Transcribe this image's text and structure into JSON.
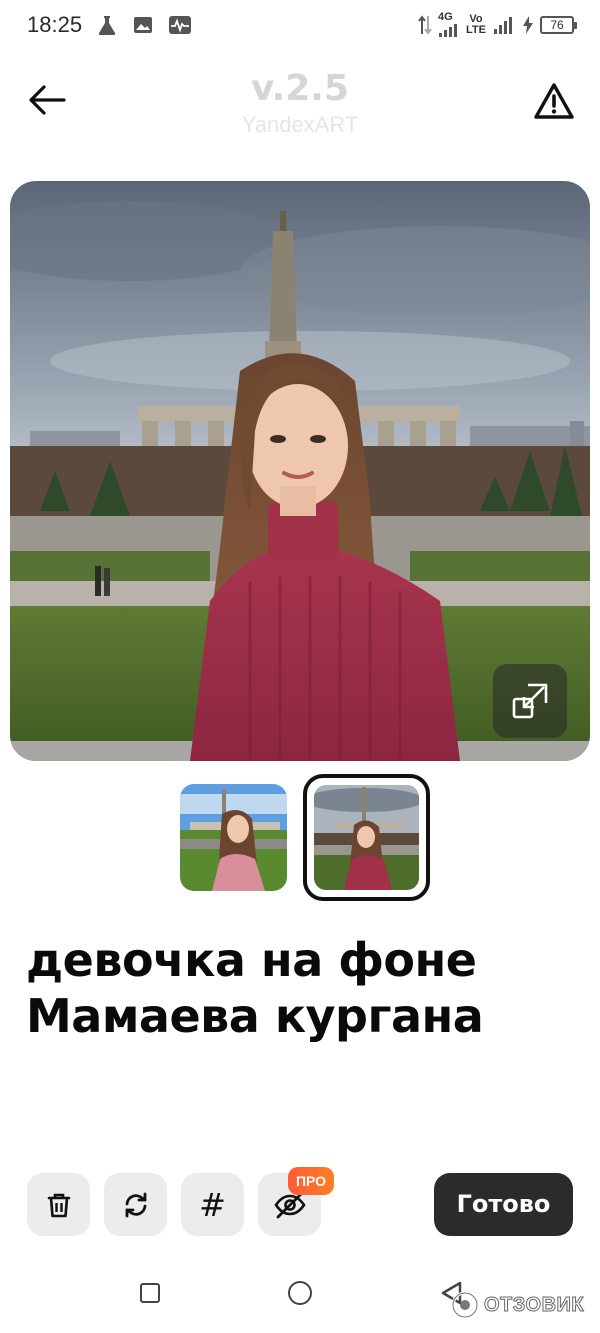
{
  "status_bar": {
    "time": "18:25",
    "network_type": "4G",
    "volte_top": "Vo",
    "volte_bottom": "LTE",
    "battery_level": "76",
    "icons": [
      "flask-icon",
      "image-icon",
      "activity-monitor-icon",
      "data-arrows-icon",
      "signal-icon",
      "charging-icon",
      "battery-icon"
    ]
  },
  "header": {
    "version": "v.2.5",
    "brand": "YandexART",
    "back_icon": "arrow-left-icon",
    "warning_icon": "warning-triangle-icon"
  },
  "main_image": {
    "description_icon": "photo",
    "expand_icon": "expand-icon"
  },
  "thumbnails": {
    "count": 2,
    "selected_index": 1
  },
  "prompt": {
    "text": "девочка на фоне Мамаева кургана"
  },
  "toolbar": {
    "delete_icon": "trash-icon",
    "regenerate_icon": "refresh-icon",
    "hashtag_glyph": "#",
    "hide_icon": "eye-off-icon",
    "pro_badge": "ПРО",
    "done_label": "Готово"
  },
  "nav_bar": {
    "icons": [
      "recent-apps-icon",
      "home-icon",
      "back-triangle-icon"
    ]
  },
  "watermark": {
    "text": "ОТЗОВИК"
  },
  "colors": {
    "accent_dark": "#2b2b2b",
    "tool_bg": "#ececec",
    "pro_badge": "#ff6a2e",
    "version_text": "#d6d6d6"
  }
}
